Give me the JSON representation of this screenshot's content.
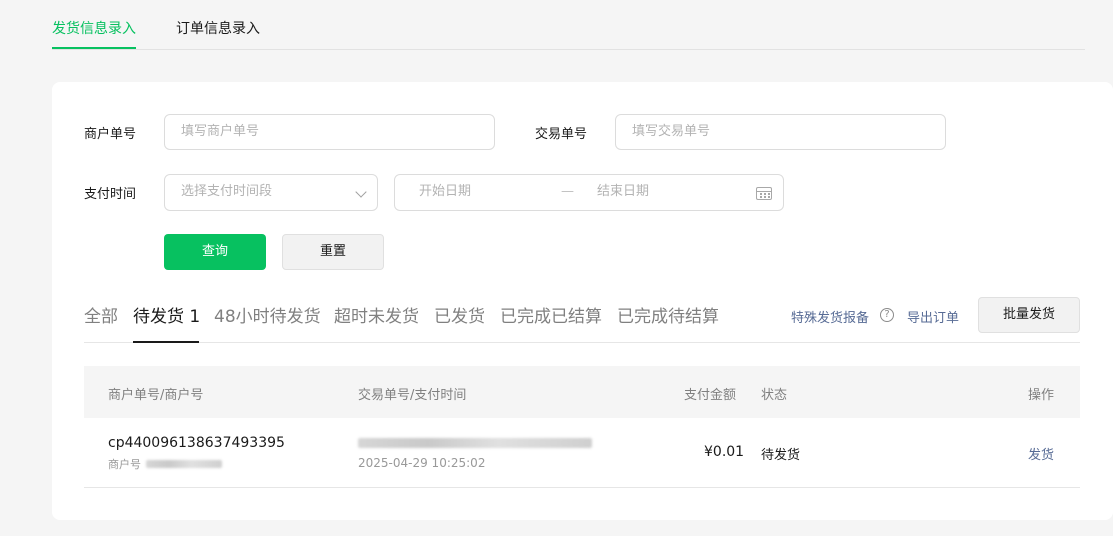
{
  "top_tabs": {
    "shipping_entry": "发货信息录入",
    "order_entry": "订单信息录入"
  },
  "filters": {
    "merchant_no_label": "商户单号",
    "merchant_no_placeholder": "填写商户单号",
    "trade_no_label": "交易单号",
    "trade_no_placeholder": "填写交易单号",
    "pay_time_label": "支付时间",
    "pay_time_select_placeholder": "选择支付时间段",
    "start_date_placeholder": "开始日期",
    "date_separator": "—",
    "end_date_placeholder": "结束日期",
    "search_button": "查询",
    "reset_button": "重置"
  },
  "status_tabs": [
    "全部",
    "待发货 1",
    "48小时待发货",
    "超时未发货",
    "已发货",
    "已完成已结算",
    "已完成待结算"
  ],
  "active_status_tab": "待发货 1",
  "actions": {
    "special_report": "特殊发货报备",
    "export_orders": "导出订单",
    "batch_ship": "批量发货"
  },
  "table": {
    "headers": {
      "merchant": "商户单号/商户号",
      "trade": "交易单号/支付时间",
      "amount": "支付金额",
      "status": "状态",
      "operation": "操作"
    },
    "rows": [
      {
        "merchant_order_no": "cp440096138637493395",
        "merchant_id_label": "商户号",
        "pay_time": "2025-04-29 10:25:02",
        "amount": "¥0.01",
        "status": "待发货",
        "operation": "发货"
      }
    ]
  },
  "colors": {
    "accent": "#07c160",
    "link": "#576b95"
  }
}
